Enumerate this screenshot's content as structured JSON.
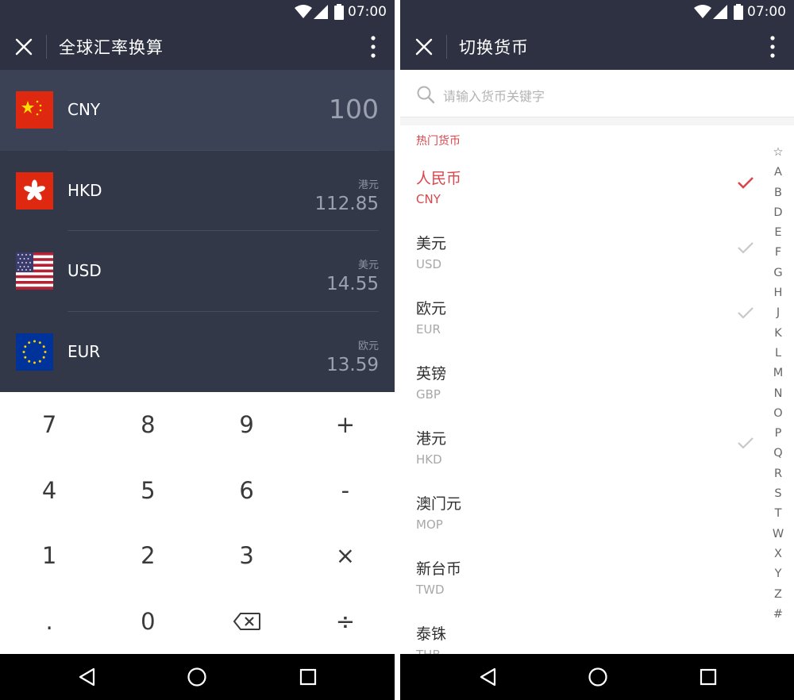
{
  "status": {
    "time": "07:00"
  },
  "converter": {
    "title": "全球汇率换算",
    "rows": [
      {
        "code": "CNY",
        "name": "",
        "value": "100",
        "flag": "china-flag-icon"
      },
      {
        "code": "HKD",
        "name": "港元",
        "value": "112.85",
        "flag": "hong-kong-flag-icon"
      },
      {
        "code": "USD",
        "name": "美元",
        "value": "14.55",
        "flag": "usa-flag-icon"
      },
      {
        "code": "EUR",
        "name": "欧元",
        "value": "13.59",
        "flag": "eu-flag-icon"
      }
    ],
    "keys": [
      "7",
      "8",
      "9",
      "+",
      "4",
      "5",
      "6",
      "-",
      "1",
      "2",
      "3",
      "×",
      ".",
      "0",
      "⌫",
      "÷"
    ]
  },
  "switcher": {
    "title": "切换货币",
    "search_placeholder": "请输入货币关键字",
    "section_title": "热门货币",
    "items": [
      {
        "cn": "人民币",
        "code": "CNY",
        "state": "selected"
      },
      {
        "cn": "美元",
        "code": "USD",
        "state": "checked"
      },
      {
        "cn": "欧元",
        "code": "EUR",
        "state": "checked"
      },
      {
        "cn": "英镑",
        "code": "GBP",
        "state": "none"
      },
      {
        "cn": "港元",
        "code": "HKD",
        "state": "checked"
      },
      {
        "cn": "澳门元",
        "code": "MOP",
        "state": "none"
      },
      {
        "cn": "新台币",
        "code": "TWD",
        "state": "none"
      },
      {
        "cn": "泰铢",
        "code": "THB",
        "state": "none"
      }
    ],
    "alphabet": [
      "☆",
      "A",
      "B",
      "D",
      "E",
      "F",
      "G",
      "H",
      "J",
      "K",
      "L",
      "M",
      "N",
      "O",
      "P",
      "Q",
      "R",
      "S",
      "T",
      "W",
      "X",
      "Y",
      "Z",
      "#"
    ]
  },
  "colors": {
    "accent": "#d9464c",
    "bar": "#2d3142",
    "list_bg": "#333849"
  }
}
